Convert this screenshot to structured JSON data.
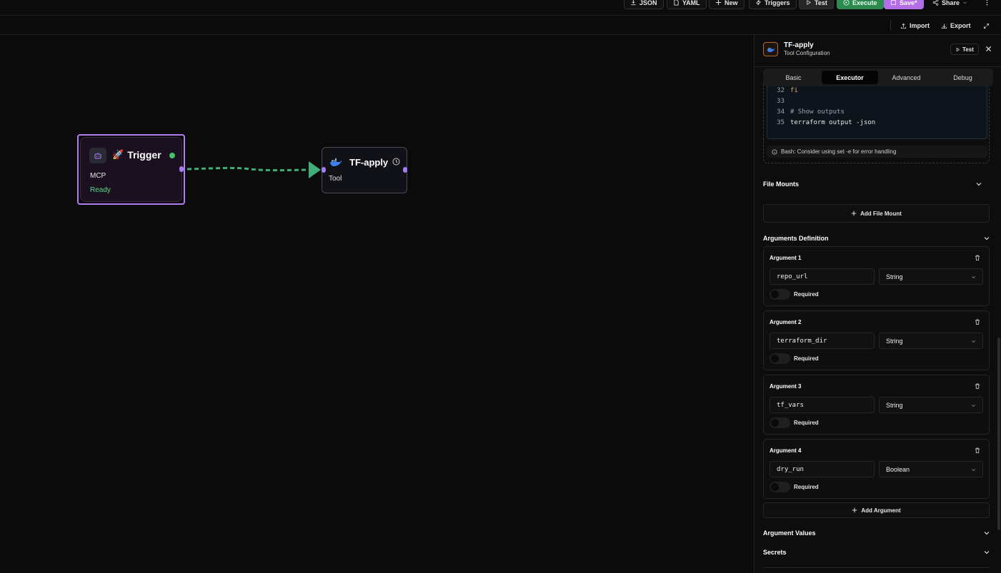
{
  "toolbar": {
    "json_label": "JSON",
    "yaml_label": "YAML",
    "new_label": "New",
    "triggers_label": "Triggers",
    "test_label": "Test",
    "execute_label": "Execute",
    "save_label": "Save*",
    "share_label": "Share"
  },
  "subbar": {
    "import_label": "Import",
    "export_label": "Export"
  },
  "canvas": {
    "trigger_node": {
      "title": "Trigger",
      "emoji": "🚀",
      "subtitle": "MCP",
      "status": "Ready"
    },
    "tool_node": {
      "title": "TF-apply",
      "subtitle": "Tool"
    }
  },
  "panel": {
    "title": "TF-apply",
    "subtitle": "Tool Configuration",
    "test_label": "Test",
    "tabs": [
      {
        "label": "Basic"
      },
      {
        "label": "Executor"
      },
      {
        "label": "Advanced"
      },
      {
        "label": "Debug"
      }
    ],
    "code_lines": [
      {
        "n": "32",
        "text": "fi"
      },
      {
        "n": "33",
        "text": ""
      },
      {
        "n": "34",
        "text": "# Show outputs"
      },
      {
        "n": "35",
        "text": "terraform output -json"
      }
    ],
    "warning": "Bash: Consider using set -e for error handling",
    "file_mounts_title": "File Mounts",
    "add_file_mount_label": "Add File Mount",
    "arguments_title": "Arguments Definition",
    "arguments": [
      {
        "title": "Argument 1",
        "name": "repo_url",
        "type": "String",
        "required_label": "Required"
      },
      {
        "title": "Argument 2",
        "name": "terraform_dir",
        "type": "String",
        "required_label": "Required"
      },
      {
        "title": "Argument 3",
        "name": "tf_vars",
        "type": "String",
        "required_label": "Required"
      },
      {
        "title": "Argument 4",
        "name": "dry_run",
        "type": "Boolean",
        "required_label": "Required"
      }
    ],
    "add_argument_label": "Add Argument",
    "argument_values_title": "Argument Values",
    "secrets_title": "Secrets"
  }
}
